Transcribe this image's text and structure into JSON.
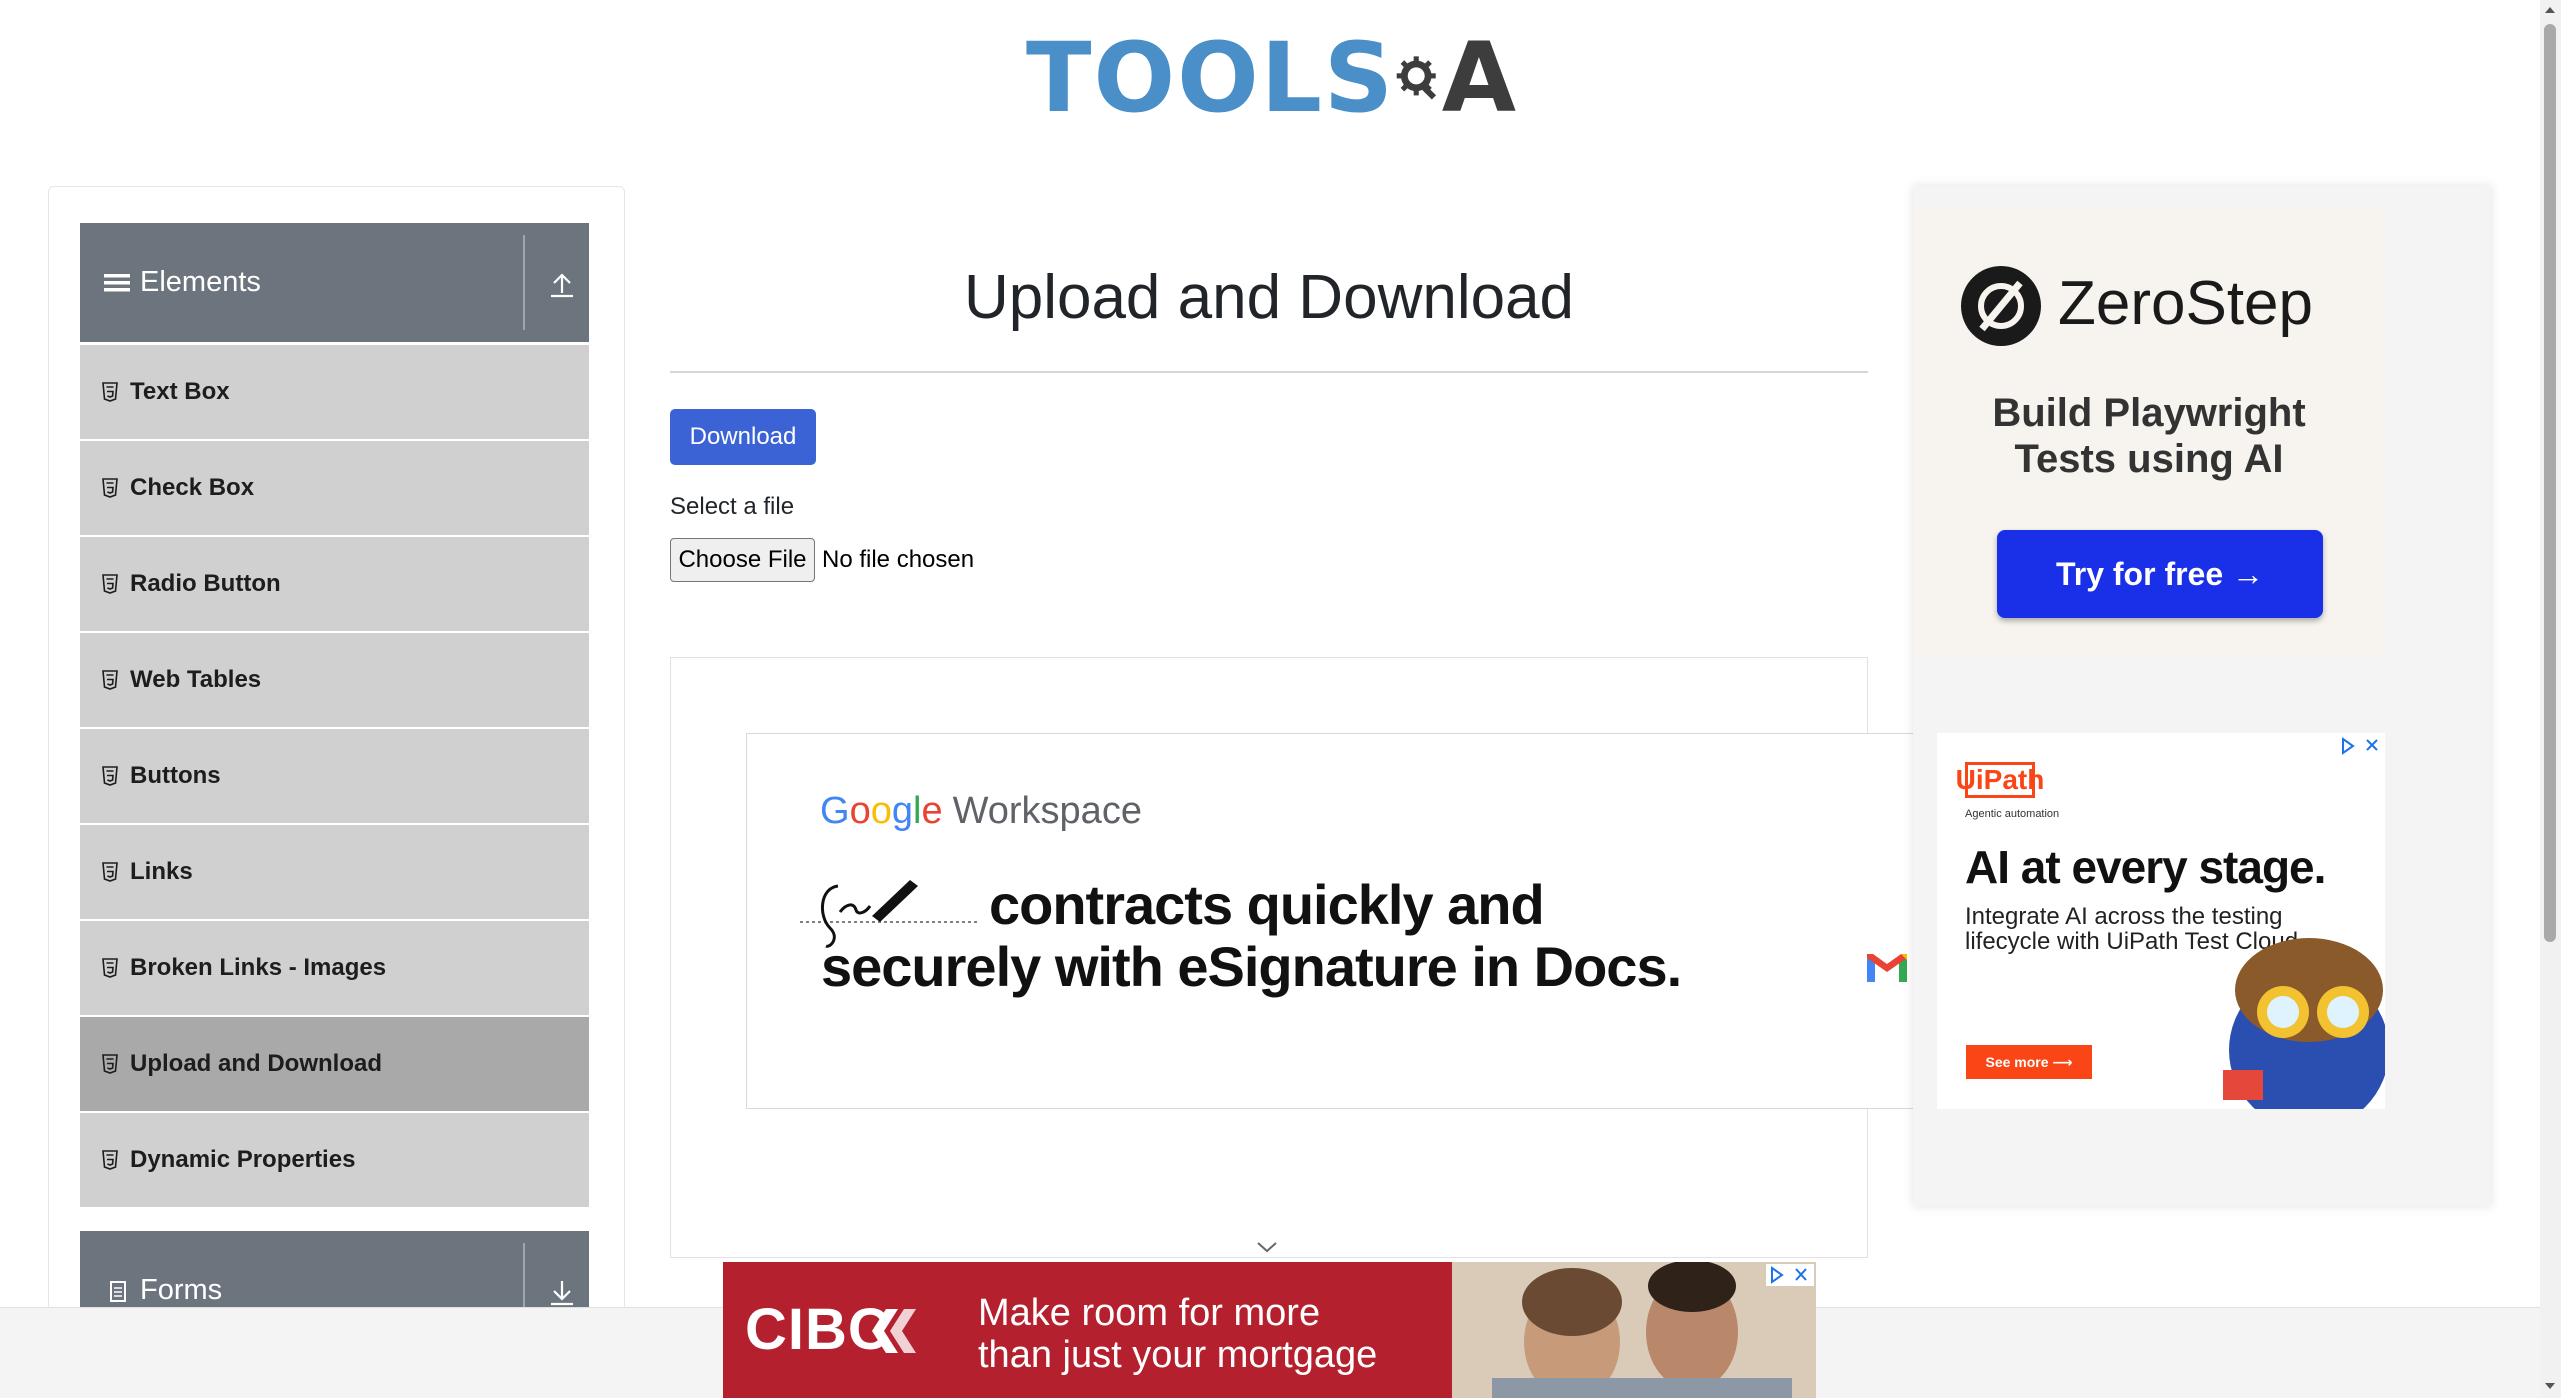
{
  "header": {
    "logo_text": "TOOLS",
    "logo_suffix": "A"
  },
  "sidebar": {
    "groups": [
      {
        "label": "Elements",
        "items": [
          {
            "label": "Text Box"
          },
          {
            "label": "Check Box"
          },
          {
            "label": "Radio Button"
          },
          {
            "label": "Web Tables"
          },
          {
            "label": "Buttons"
          },
          {
            "label": "Links"
          },
          {
            "label": "Broken Links - Images"
          },
          {
            "label": "Upload and Download",
            "active": true
          },
          {
            "label": "Dynamic Properties"
          }
        ]
      },
      {
        "label": "Forms",
        "items": []
      }
    ]
  },
  "main": {
    "title": "Upload and Download",
    "download_label": "Download",
    "select_label": "Select a file",
    "choose_file_label": "Choose File",
    "no_file_text": "No file chosen"
  },
  "ads": {
    "google": {
      "brand_letters": [
        "G",
        "o",
        "o",
        "g",
        "l",
        "e"
      ],
      "product": "Workspace",
      "line1": "contracts quickly and",
      "line2": "securely with eSignature in Docs."
    },
    "zerostep": {
      "name": "ZeroStep",
      "tagline_1": "Build Playwright",
      "tagline_2": "Tests using AI",
      "cta": "Try for free →"
    },
    "uipath": {
      "logo": "UiPath",
      "sub": "Agentic automation",
      "headline": "AI at every stage.",
      "body": "Integrate AI across the testing lifecycle with UiPath Test Cloud.",
      "cta": "See more ⟶"
    },
    "cibc": {
      "logo": "CIBC",
      "line1": "Make room for more",
      "line2": "than just your mortgage"
    }
  },
  "colors": {
    "sidebar_header": "#6c757d",
    "sidebar_item": "#d0d0d0",
    "sidebar_active": "#a9a9a9",
    "primary_button": "#3b63d6",
    "zerostep_button": "#1a2fe8",
    "uipath_orange": "#fa4616",
    "cibc_red": "#b5202e"
  }
}
